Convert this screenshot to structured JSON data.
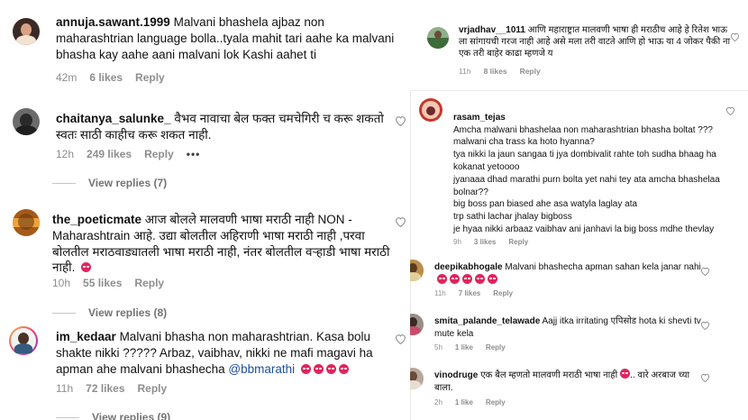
{
  "left_comments": [
    {
      "username": "annuja.sawant.1999",
      "text": "Malvani bhashela ajbaz non maharashtrian language bolla..tyala mahit tari aahe ka malvani bhasha kay aahe aani malvani lok Kashi aahet ti",
      "time": "42m",
      "likes": "6 likes",
      "reply": "Reply"
    },
    {
      "username": "chaitanya_salunke_",
      "text": "वैभव नावाचा बेल फक्त चमचेगिरी च करू शकतो स्वतः साठी काहीच करू शकत नाही.",
      "time": "12h",
      "likes": "249 likes",
      "reply": "Reply",
      "more": "•••",
      "view_replies": "View replies (7)"
    },
    {
      "username": "the_poeticmate",
      "text": "आज बोलले मालवणी भाषा मराठी नाही NON - Maharashtrain आहे. उद्या बोलतील अहिराणी भाषा मराठी नाही ,परवा बोलतील मराठवाड्यातली भाषा मराठी नाही, नंतर बोलतील वऱ्हाडी भाषा मराठी नाही.",
      "time": "10h",
      "likes": "55 likes",
      "reply": "Reply",
      "view_replies": "View replies (8)"
    },
    {
      "username": "im_kedaar",
      "text_a": "Malvani bhasha non maharashtrian. Kasa bolu shakte nikki ????? Arbaz, vaibhav, nikki ne mafi magavi ha apman ahe malvani bhashecha",
      "mention": "@bbmarathi",
      "time": "11h",
      "likes": "72 likes",
      "reply": "Reply",
      "view_replies": "View replies (9)"
    }
  ],
  "right_top_comment": {
    "username": "vrjadhav__1011",
    "text": "आणि महाराष्ट्रात मालवणी भाषा ही मराठीच आहे हे रितेश भाऊ ला सांगायची गरज नाही आहे असे मला तरी वाटते आणि हो भाऊ या 4 जोकर पैकी ना एक तरी बाहेर काढा म्हणजे य",
    "time": "11h",
    "likes": "8 likes",
    "reply": "Reply"
  },
  "right_comments": [
    {
      "username": "rasam_tejas",
      "text": "Amcha malwani bhashelaa non maharashtrian bhasha boltat ???\nmalwani cha trass ka hoto hyanna?\ntya nikki la jaun sangaa ti jya dombivalit rahte toh sudha bhaag ha kokanat yetoooo\njyanaaa dhad marathi purn bolta yet nahi tey ata amcha bhashelaa bolnar??\nbig boss pan biased ahe asa watyla laglay ata\ntrp sathi lachar jhalay bigboss\nje hyaa nikki arbaaz vaibhav ani janhavi la big boss mdhe thevlay",
      "time": "9h",
      "likes": "3 likes",
      "reply": "Reply"
    },
    {
      "username": "deepikabhogale",
      "text": "Malvani bhashecha apman sahan kela janar nahi",
      "time": "11h",
      "likes": "7 likes",
      "reply": "Reply"
    },
    {
      "username": "smita_palande_telawade",
      "text": "Aajj itka irritating एपिसोड hota ki shevti tv mute kela",
      "time": "5h",
      "likes": "1 like",
      "reply": "Reply"
    },
    {
      "username": "vinodruge",
      "text": "एक बैल म्हणतो मालवणी मराठी भाषा नाही",
      "text_b": ".. वारे अरबाज च्या बाला.",
      "time": "2h",
      "likes": "1 like",
      "reply": "Reply"
    }
  ]
}
